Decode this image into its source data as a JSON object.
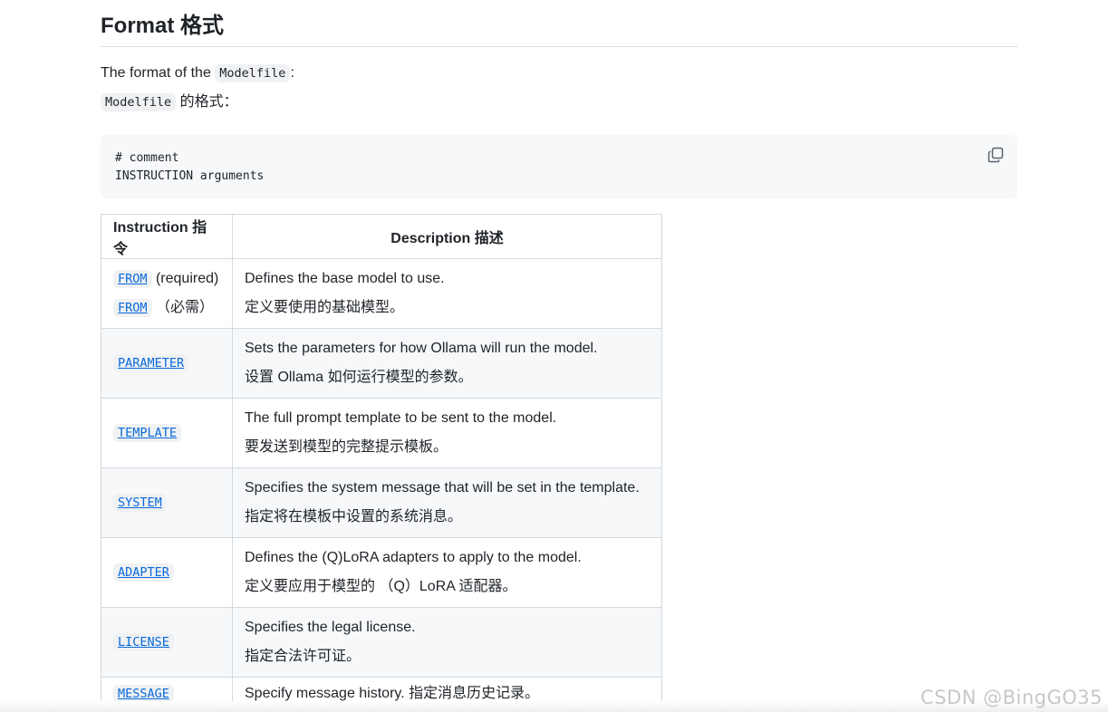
{
  "heading": "Format 格式",
  "intro": {
    "line1_prefix": "The format of the ",
    "line1_code": "Modelfile",
    "line1_suffix": ":",
    "line2_code": "Modelfile",
    "line2_suffix": " 的格式："
  },
  "codeblock": {
    "line1": "# comment",
    "line2": "INSTRUCTION arguments",
    "copy_icon": "copy-icon"
  },
  "table": {
    "headers": {
      "instruction": "Instruction 指令",
      "description": "Description 描述"
    },
    "rows": [
      {
        "kw": "FROM",
        "note": " (required)",
        "kw2": "FROM",
        "note2": " （必需）",
        "desc_en": "Defines the base model to use.",
        "desc_zh": "定义要使用的基础模型。"
      },
      {
        "kw": "PARAMETER",
        "desc_en": "Sets the parameters for how Ollama will run the model.",
        "desc_zh": "设置 Ollama 如何运行模型的参数。"
      },
      {
        "kw": "TEMPLATE",
        "desc_en": "The full prompt template to be sent to the model.",
        "desc_zh": "要发送到模型的完整提示模板。"
      },
      {
        "kw": "SYSTEM",
        "desc_en": "Specifies the system message that will be set in the template.",
        "desc_zh": "指定将在模板中设置的系统消息。"
      },
      {
        "kw": "ADAPTER",
        "desc_en": "Defines the (Q)LoRA adapters to apply to the model.",
        "desc_zh": "定义要应用于模型的 （Q）LoRA 适配器。"
      },
      {
        "kw": "LICENSE",
        "desc_en": "Specifies the legal license.",
        "desc_zh": "指定合法许可证。"
      },
      {
        "kw": "MESSAGE",
        "desc": "Specify message history. 指定消息历史记录。"
      }
    ]
  },
  "watermark": "CSDN @BingGO35"
}
